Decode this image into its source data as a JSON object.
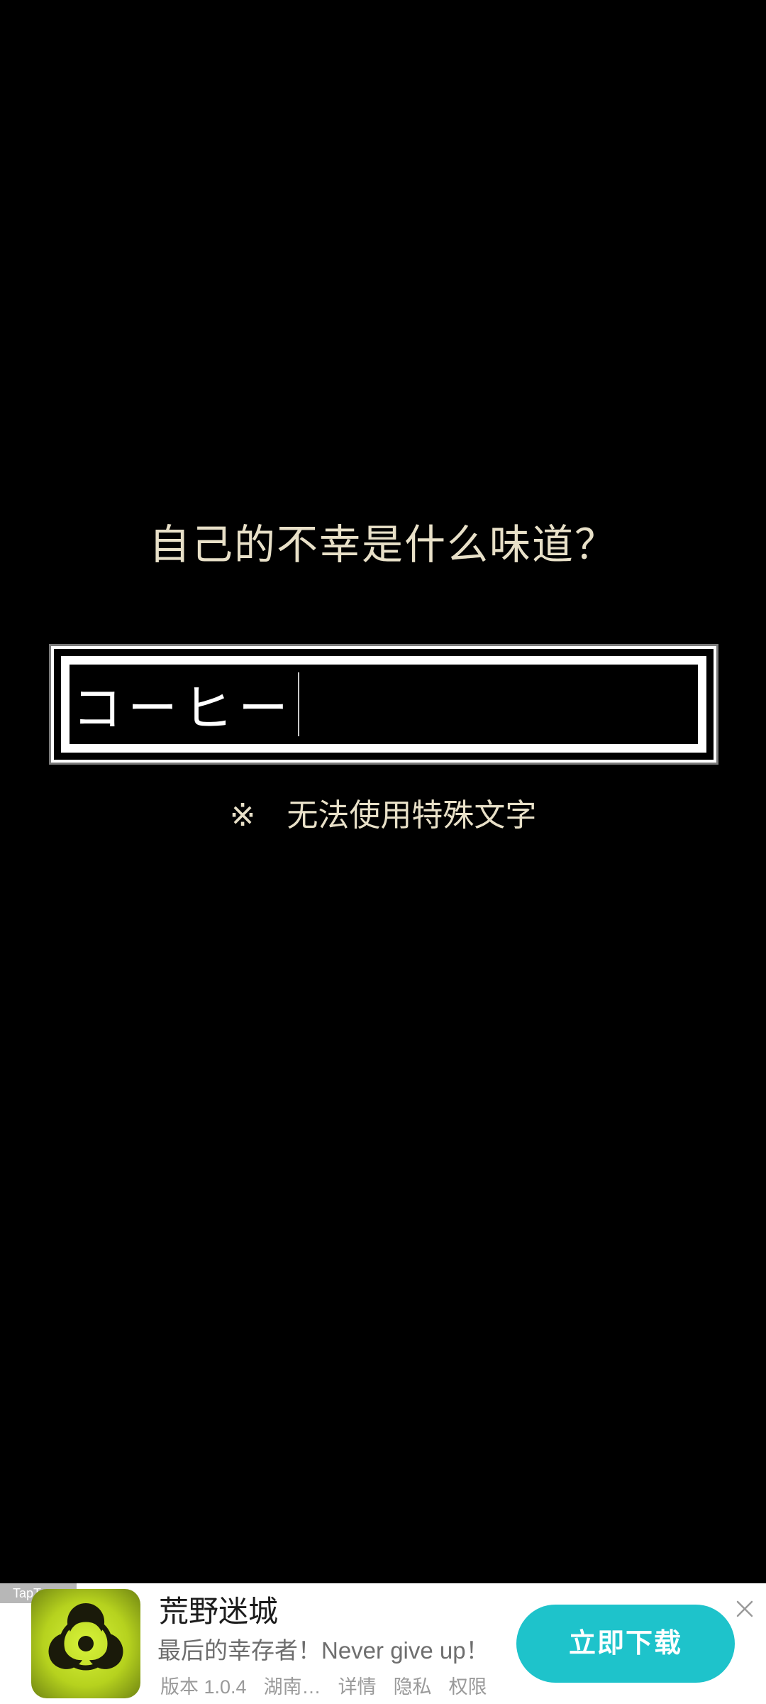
{
  "game": {
    "prompt": "自己的不幸是什么味道？",
    "input_value": "コーヒー",
    "note_mark": "※",
    "note_text": "无法使用特殊文字"
  },
  "ad": {
    "tag": "TapTap",
    "app_icon": "biohazard-icon",
    "app_name": "荒野迷城",
    "subtitle": "最后的幸存者！Never give up！",
    "version": "版本 1.0.4",
    "developer": "湖南…",
    "details": "详情",
    "privacy": "隐私",
    "permissions": "权限",
    "cta": "立即下载",
    "accent_color": "#1ec3cb"
  }
}
